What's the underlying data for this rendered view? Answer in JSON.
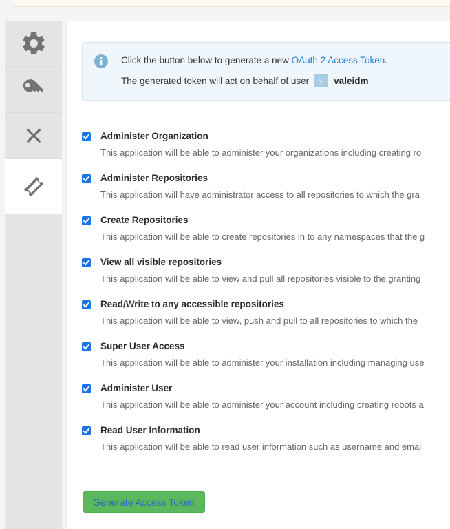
{
  "window": {
    "title": "Generate Access Token"
  },
  "sidebar": {
    "items": [
      {
        "name": "settings",
        "icon": "gear-icon",
        "active": false
      },
      {
        "name": "credentials",
        "icon": "key-icon",
        "active": false
      },
      {
        "name": "delete",
        "icon": "close-x-icon",
        "active": false
      },
      {
        "name": "access-token",
        "icon": "ticket-icon",
        "active": true
      }
    ]
  },
  "alert": {
    "icon": "info-circle-icon",
    "line1_before": "Click the button below to generate a new ",
    "line1_link": "OAuth 2 Access Token",
    "line1_after": ".",
    "line2_before": "The generated token will act on behalf of user",
    "avatar_initial": "V",
    "username": "valeidm"
  },
  "scopes": [
    {
      "title": "Administer Organization",
      "description": "This application will be able to administer your organizations including creating ro",
      "checked": true
    },
    {
      "title": "Administer Repositories",
      "description": "This application will have administrator access to all repositories to which the gra",
      "checked": true
    },
    {
      "title": "Create Repositories",
      "description": "This application will be able to create repositories in to any namespaces that the g",
      "checked": true
    },
    {
      "title": "View all visible repositories",
      "description": "This application will be able to view and pull all repositories visible to the granting",
      "checked": true
    },
    {
      "title": "Read/Write to any accessible repositories",
      "description": "This application will be able to view, push and pull to all repositories to which the",
      "checked": true
    },
    {
      "title": "Super User Access",
      "description": "This application will be able to administer your installation including managing use",
      "checked": true
    },
    {
      "title": "Administer User",
      "description": "This application will be able to administer your account including creating robots a",
      "checked": true
    },
    {
      "title": "Read User Information",
      "description": "This application will be able to read user information such as username and emai",
      "checked": true
    }
  ],
  "actions": {
    "generate_label": "Generate Access Token"
  },
  "colors": {
    "page_background": "#f4f4f4",
    "panel_background": "#ffffff",
    "rail_background": "#e4e4e4",
    "top_banner": "#fdf8ef",
    "alert_background": "#eff7fd",
    "alert_border": "#d4e7f5",
    "link": "#1b7dd4",
    "checkbox": "#1676e8",
    "button_green": "#5cb85c",
    "button_text": "#2a6dbd",
    "avatar": "#a7cbe0",
    "icon_gray": "#737373",
    "description_text": "#666666"
  }
}
